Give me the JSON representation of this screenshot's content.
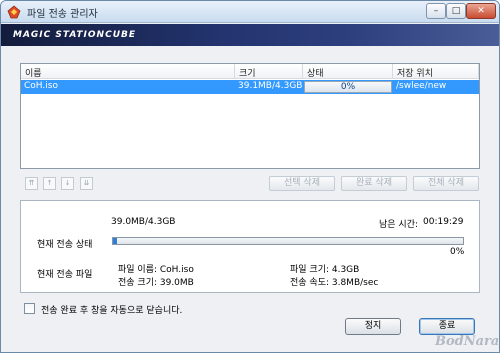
{
  "window": {
    "title": "파일 전송 관리자"
  },
  "banner": {
    "brand": "MAGIC STATIONCUBE"
  },
  "list": {
    "columns": [
      "이름",
      "크기",
      "상태",
      "저장 위치"
    ],
    "rows": [
      {
        "name": "CoH.iso",
        "size": "39.1MB/4.3GB",
        "status": "0%",
        "location": "/swlee/new"
      }
    ]
  },
  "list_controls": {
    "move_buttons": [
      "move-top-icon",
      "move-up-icon",
      "move-down-icon",
      "move-bottom-icon"
    ],
    "delete_selected": "선택 삭제",
    "delete_completed": "완료 삭제",
    "delete_all": "전체 삭제"
  },
  "transfer": {
    "amount": "39.0MB/4.3GB",
    "remaining_label": "남은 시간:",
    "remaining_value": "00:19:29",
    "status_label": "현재 전송 상태",
    "percent_text": "0%",
    "progress_fraction": 0.01,
    "file_label": "현재 전송 파일",
    "file_name": "파일 이름: CoH.iso",
    "file_size": "파일 크기: 4.3GB",
    "transferred": "전송 크기: 39.0MB",
    "speed": "전송 속도: 3.8MB/sec"
  },
  "options": {
    "close_after": "전송 완료 후 창을 자동으로 닫습니다.",
    "close_after_checked": false
  },
  "buttons": {
    "stop": "정지",
    "exit": "종료"
  },
  "watermark": "BodNara",
  "colors": {
    "selection": "#3399ff",
    "banner": "#233470",
    "progress": "#2f7fd6"
  }
}
